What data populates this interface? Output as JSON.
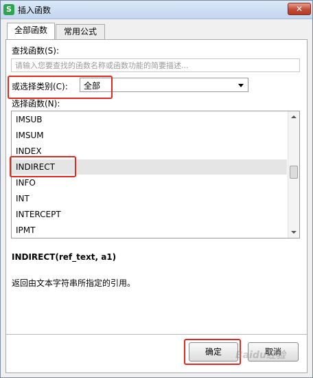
{
  "window": {
    "title": "插入函数",
    "app_icon_glyph": "S",
    "close_glyph": "✕",
    "close_color": "#c24b36"
  },
  "tabs": [
    {
      "label": "全部函数",
      "active": true
    },
    {
      "label": "常用公式",
      "active": false
    }
  ],
  "search": {
    "label": "查找函数(S):",
    "placeholder": "请输入您要查找的函数名称或函数功能的简要描述...",
    "value": ""
  },
  "category": {
    "label": "或选择类别(C):",
    "selected": "全部"
  },
  "function_list": {
    "label": "选择函数(N):",
    "items": [
      "IMSUB",
      "IMSUM",
      "INDEX",
      "INDIRECT",
      "INFO",
      "INT",
      "INTERCEPT",
      "IPMT"
    ],
    "selected": "INDIRECT"
  },
  "details": {
    "signature": "INDIRECT(ref_text, a1)",
    "description": "返回由文本字符串所指定的引用。"
  },
  "buttons": {
    "ok_label": "确定",
    "cancel_label": "取消"
  },
  "watermark_text": "Baidu经验",
  "colors": {
    "highlight": "#e0281e",
    "selected_row": "#e5e5e5"
  }
}
